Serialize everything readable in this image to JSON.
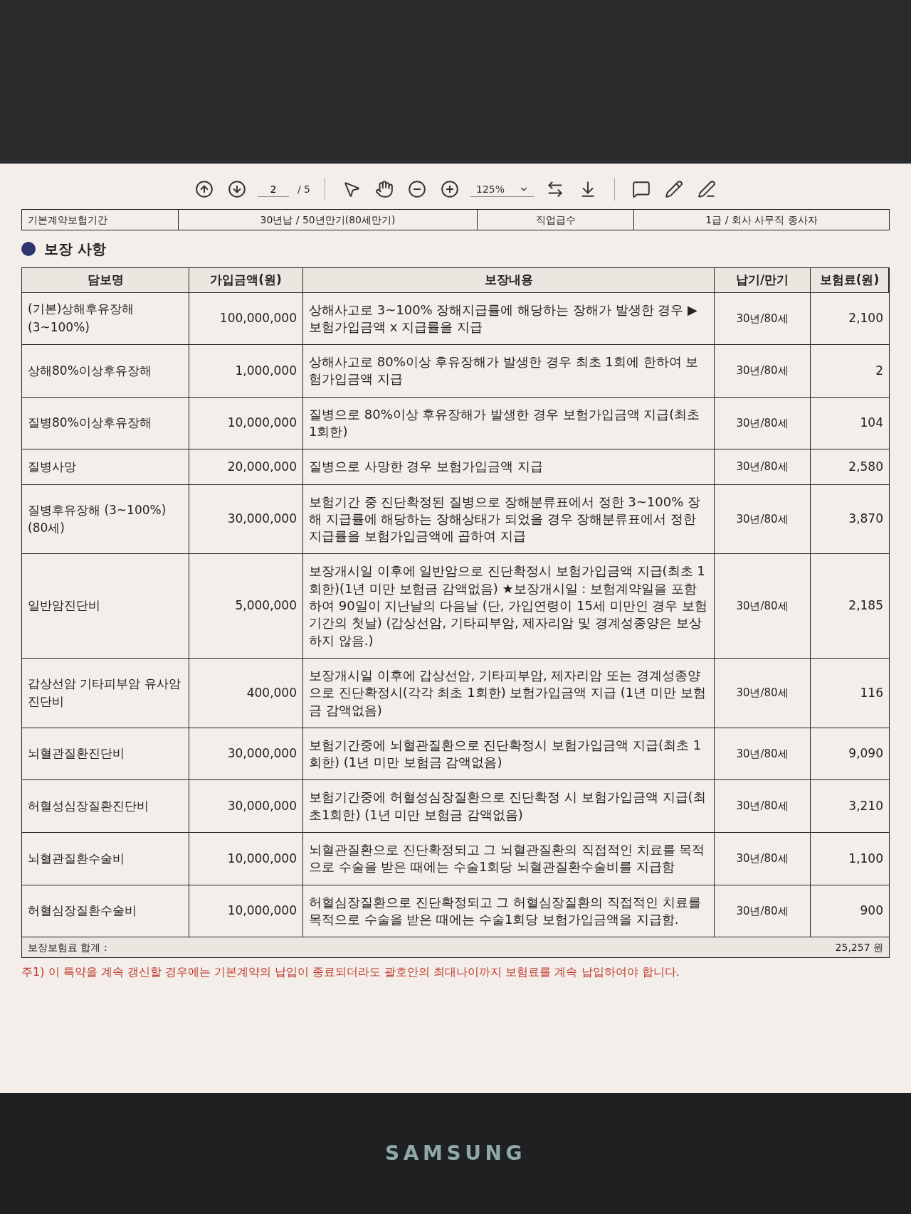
{
  "toolbar": {
    "page": "2",
    "page_total": "/ 5",
    "zoom": "125%"
  },
  "info_row": {
    "label": "기본계약보험기간",
    "value": "30년납 / 50년만기(80세만기)",
    "label_2": "직업급수",
    "value_2": "1급 / 회사 사무직 종사자"
  },
  "section": {
    "title": "보장 사항"
  },
  "table": {
    "columns": [
      "담보명",
      "가입금액(원)",
      "보장내용",
      "납기/만기",
      "보험료(원)"
    ],
    "rows": [
      {
        "name": "(기본)상해후유장해 (3~100%)",
        "amount": "100,000,000",
        "coverage": "상해사고로  3~100% 장해지급률에 해당하는 장해가 발생한 경우 ▶보험가입금액 x 지급률을 지급",
        "term": "30년/80세",
        "premium": "2,100"
      },
      {
        "name": "상해80%이상후유장해",
        "amount": "1,000,000",
        "coverage": "상해사고로 80%이상 후유장해가 발생한 경우 최초 1회에 한하여 보험가입금액 지급",
        "term": "30년/80세",
        "premium": "2"
      },
      {
        "name": "질병80%이상후유장해",
        "amount": "10,000,000",
        "coverage": "질병으로 80%이상 후유장해가 발생한 경우 보험가입금액 지급(최초 1회한)",
        "term": "30년/80세",
        "premium": "104"
      },
      {
        "name": "질병사망",
        "amount": "20,000,000",
        "coverage": "질병으로 사망한 경우 보험가입금액 지급",
        "term": "30년/80세",
        "premium": "2,580"
      },
      {
        "name": "질병후유장해 (3~100%)(80세)",
        "amount": "30,000,000",
        "coverage": "보험기간 중 진단확정된 질병으로 장해분류표에서 정한 3~100% 장해 지급률에 해당하는 장해상태가 되었을 경우 장해분류표에서 정한 지급률을 보험가입금액에 곱하여 지급",
        "term": "30년/80세",
        "premium": "3,870"
      },
      {
        "name": "일반암진단비",
        "amount": "5,000,000",
        "coverage": "보장개시일 이후에 일반암으로 진단확정시 보험가입금액 지급(최초 1회한)(1년 미만 보험금 감액없음) ★보장개시일 : 보험계약일을 포함하여 90일이 지난날의 다음날 (단, 가입연령이 15세 미만인 경우 보험기간의 첫날) (갑상선암, 기타피부암, 제자리암 및 경계성종양은 보상하지 않음.)",
        "term": "30년/80세",
        "premium": "2,185"
      },
      {
        "name": "갑상선암 기타피부암 유사암진단비",
        "amount": "400,000",
        "coverage": "보장개시일 이후에 갑상선암, 기타피부암, 제자리암 또는 경계성종양으로 진단확정시(각각 최초 1회한) 보험가입금액 지급 (1년 미만 보험금 감액없음)",
        "term": "30년/80세",
        "premium": "116"
      },
      {
        "name": "뇌혈관질환진단비",
        "amount": "30,000,000",
        "coverage": "보험기간중에 뇌혈관질환으로 진단확정시 보험가입금액 지급(최초 1회한) (1년 미만 보험금 감액없음)",
        "term": "30년/80세",
        "premium": "9,090"
      },
      {
        "name": "허혈성심장질환진단비",
        "amount": "30,000,000",
        "coverage": "보험기간중에 허혈성심장질환으로 진단확정 시 보험가입금액 지급(최초1회한) (1년 미만 보험금 감액없음)",
        "term": "30년/80세",
        "premium": "3,210"
      },
      {
        "name": "뇌혈관질환수술비",
        "amount": "10,000,000",
        "coverage": "뇌혈관질환으로 진단확정되고 그 뇌혈관질환의 직접적인 치료를 목적으로 수술을 받은 때에는 수술1회당 뇌혈관질환수술비를 지급함",
        "term": "30년/80세",
        "premium": "1,100"
      },
      {
        "name": "허혈심장질환수술비",
        "amount": "10,000,000",
        "coverage": "허혈심장질환으로 진단확정되고 그 허혈심장질환의 직접적인 치료를 목적으로 수술을 받은 때에는 수술1회당 보험가입금액을 지급함.",
        "term": "30년/80세",
        "premium": "900"
      }
    ],
    "total_label": "보장보험료 합계 :",
    "total_value": "25,257 원"
  },
  "note": "주1) 이 특약을 계속 갱신할 경우에는 기본계약의 납입이 종료되더라도 괄호안의 최대나이까지 보험료를 계속 납입하여야 합니다.",
  "monitor": {
    "brand": "SAMSUNG"
  }
}
